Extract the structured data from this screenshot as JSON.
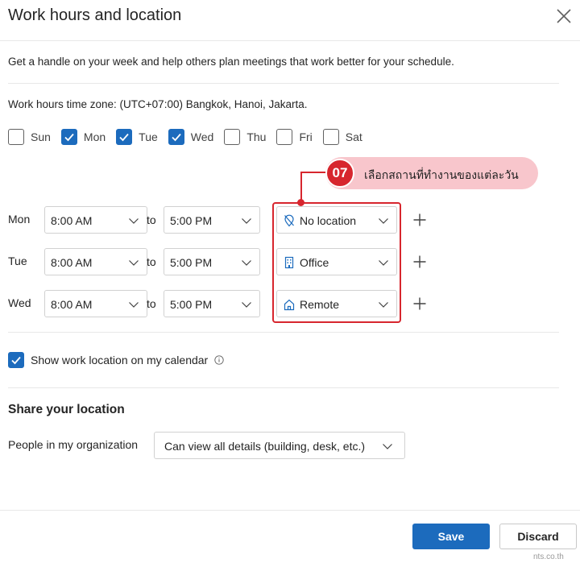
{
  "dialog": {
    "title": "Work hours and location",
    "description": "Get a handle on your week and help others plan meetings that work better for your schedule.",
    "timezone": "Work hours time zone: (UTC+07:00) Bangkok, Hanoi, Jakarta."
  },
  "days": [
    {
      "label": "Sun",
      "checked": false
    },
    {
      "label": "Mon",
      "checked": true
    },
    {
      "label": "Tue",
      "checked": true
    },
    {
      "label": "Wed",
      "checked": true
    },
    {
      "label": "Thu",
      "checked": false
    },
    {
      "label": "Fri",
      "checked": false
    },
    {
      "label": "Sat",
      "checked": false
    }
  ],
  "schedule": {
    "to_label": "to",
    "rows": [
      {
        "day": "Mon",
        "start": "8:00 AM",
        "end": "5:00 PM",
        "location": "No location",
        "location_icon": "no-location-icon"
      },
      {
        "day": "Tue",
        "start": "8:00 AM",
        "end": "5:00 PM",
        "location": "Office",
        "location_icon": "building-icon"
      },
      {
        "day": "Wed",
        "start": "8:00 AM",
        "end": "5:00 PM",
        "location": "Remote",
        "location_icon": "home-icon"
      }
    ]
  },
  "callout": {
    "number": "07",
    "text": "เลือกสถานที่ทำงานของแต่ละวัน",
    "color": "#d7262e",
    "bubble_color": "#f8c6cc"
  },
  "show_location": {
    "label": "Show work location on my calendar",
    "checked": true
  },
  "share": {
    "heading": "Share your location",
    "people_label": "People in my organization",
    "permission": "Can view all details (building, desk, etc.)"
  },
  "footer": {
    "save_label": "Save",
    "discard_label": "Discard",
    "watermark": "nts.co.th"
  },
  "colors": {
    "accent": "#1c6bbd",
    "border": "#d1d1d1"
  }
}
